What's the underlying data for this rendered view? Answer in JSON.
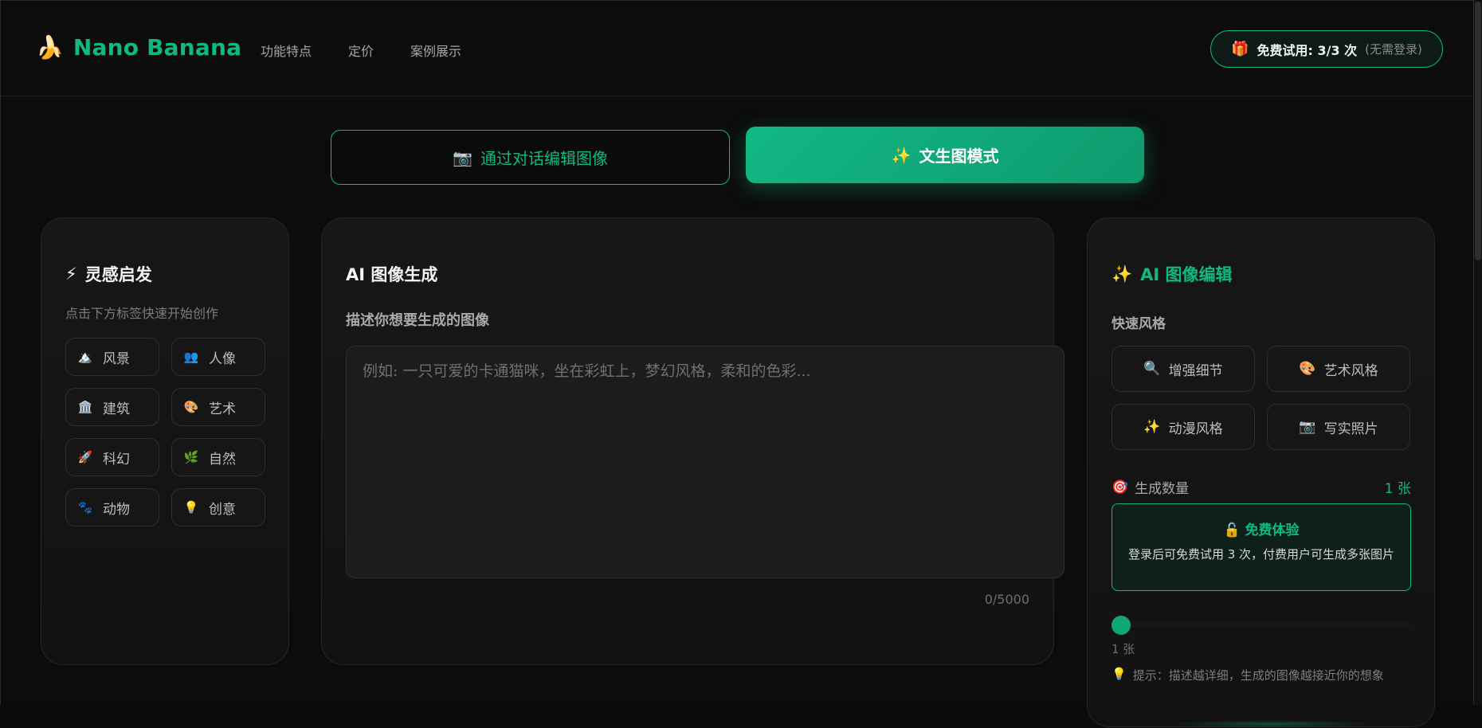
{
  "header": {
    "logo_icon": "🍌",
    "brand": "Nano Banana",
    "nav": [
      "功能特点",
      "定价",
      "案例展示"
    ],
    "trial": {
      "icon": "🎁",
      "text": "免费试用: 3/3 次",
      "sub": "(无需登录)"
    }
  },
  "modes": {
    "edit": {
      "icon": "📷",
      "label": "通过对话编辑图像"
    },
    "generate": {
      "icon": "✨",
      "label": "文生图模式"
    }
  },
  "inspiration": {
    "icon": "⚡",
    "title": "灵感启发",
    "hint": "点击下方标签快速开始创作",
    "tags": [
      {
        "icon": "🏔️",
        "label": "风景"
      },
      {
        "icon": "👥",
        "label": "人像"
      },
      {
        "icon": "🏛️",
        "label": "建筑"
      },
      {
        "icon": "🎨",
        "label": "艺术"
      },
      {
        "icon": "🚀",
        "label": "科幻"
      },
      {
        "icon": "🌿",
        "label": "自然"
      },
      {
        "icon": "🐾",
        "label": "动物"
      },
      {
        "icon": "💡",
        "label": "创意"
      }
    ]
  },
  "generator": {
    "title": "AI 图像生成",
    "label": "描述你想要生成的图像",
    "placeholder": "例如: 一只可爱的卡通猫咪，坐在彩虹上，梦幻风格，柔和的色彩...",
    "value": "",
    "counter": "0/5000"
  },
  "editor": {
    "icon": "✨",
    "title": "AI 图像编辑",
    "quick_label": "快速风格",
    "styles": [
      {
        "icon": "🔍",
        "label": "增强细节"
      },
      {
        "icon": "🎨",
        "label": "艺术风格"
      },
      {
        "icon": "✨",
        "label": "动漫风格"
      },
      {
        "icon": "📷",
        "label": "写实照片"
      }
    ],
    "count_icon": "🎯",
    "count_label": "生成数量",
    "count_value": "1 张",
    "free_box": {
      "icon": "🔓",
      "title": "免费体验",
      "desc": "登录后可免费试用 3 次，付费用户可生成多张图片"
    },
    "slider_value": 1,
    "slider_label": "1 张",
    "tip_icon": "💡",
    "tip": "提示：描述越详细，生成的图像越接近你的想象"
  }
}
